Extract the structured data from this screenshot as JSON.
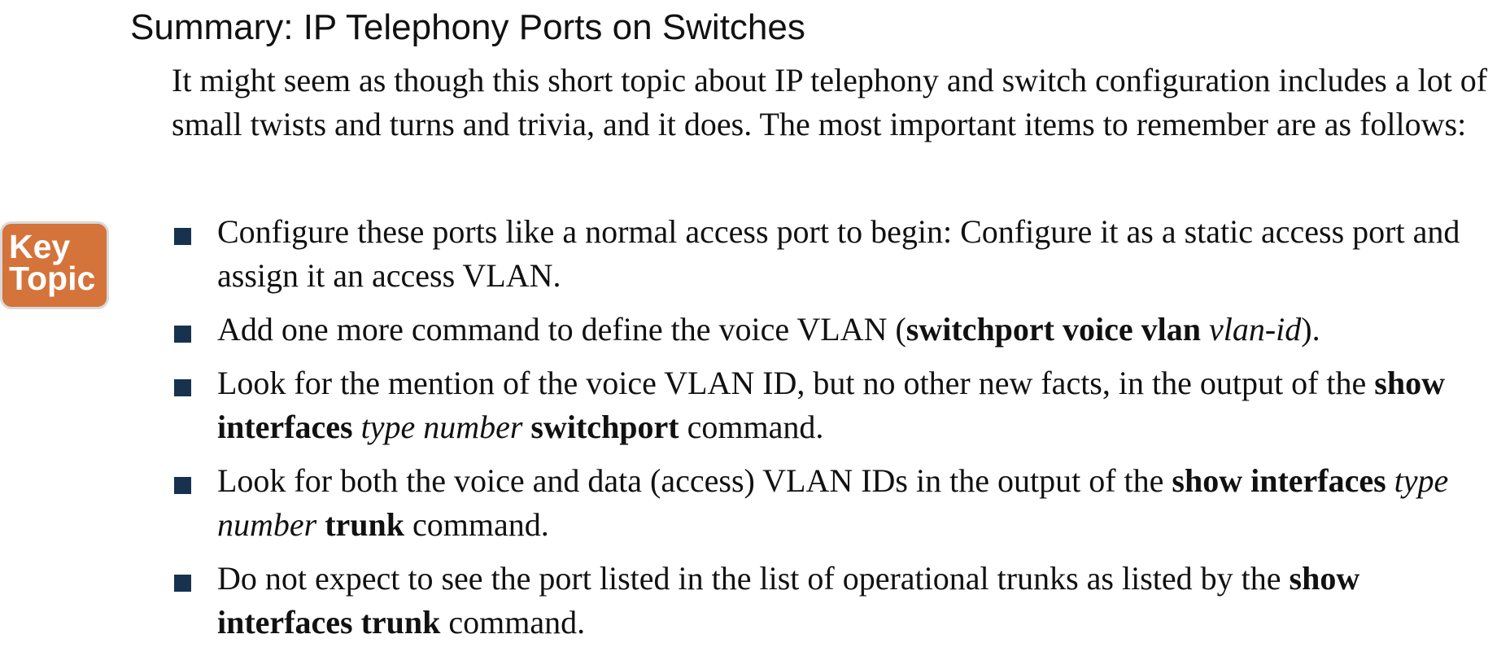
{
  "heading": "Summary: IP Telephony Ports on Switches",
  "intro": "It might seem as though this short topic about IP telephony and switch configuration includes a lot of small twists and turns and trivia, and it does. The most important items to remember are as follows:",
  "key_topic": {
    "line1": "Key",
    "line2": "Topic",
    "color": "#d4733a"
  },
  "bullet_color": "#17324f",
  "bullets": [
    {
      "parts": [
        {
          "text": "Configure these ports like a normal access port to begin: Configure it as a static access port and assign it an access VLAN.",
          "style": "normal"
        }
      ]
    },
    {
      "parts": [
        {
          "text": "Add one more command to define the voice VLAN (",
          "style": "normal"
        },
        {
          "text": "switchport voice vlan",
          "style": "bold"
        },
        {
          "text": " ",
          "style": "normal"
        },
        {
          "text": "vlan-id",
          "style": "italic"
        },
        {
          "text": ").",
          "style": "normal"
        }
      ]
    },
    {
      "parts": [
        {
          "text": "Look for the mention of the voice VLAN ID, but no other new facts, in the output of the ",
          "style": "normal"
        },
        {
          "text": "show interfaces",
          "style": "bold"
        },
        {
          "text": " ",
          "style": "normal"
        },
        {
          "text": "type number",
          "style": "italic"
        },
        {
          "text": " ",
          "style": "normal"
        },
        {
          "text": "switchport",
          "style": "bold"
        },
        {
          "text": " command.",
          "style": "normal"
        }
      ]
    },
    {
      "parts": [
        {
          "text": "Look for both the voice and data (access) VLAN IDs in the output of the ",
          "style": "normal"
        },
        {
          "text": "show interfaces",
          "style": "bold"
        },
        {
          "text": " ",
          "style": "normal"
        },
        {
          "text": "type number",
          "style": "italic"
        },
        {
          "text": " ",
          "style": "normal"
        },
        {
          "text": "trunk",
          "style": "bold"
        },
        {
          "text": " command.",
          "style": "normal"
        }
      ]
    },
    {
      "parts": [
        {
          "text": "Do not expect to see the port listed in the list of operational trunks as listed by the ",
          "style": "normal"
        },
        {
          "text": "show interfaces trunk",
          "style": "bold"
        },
        {
          "text": " command.",
          "style": "normal"
        }
      ]
    }
  ]
}
